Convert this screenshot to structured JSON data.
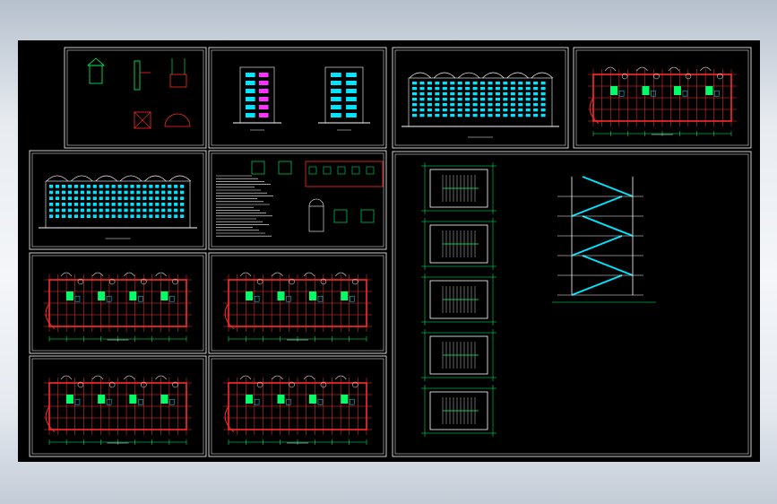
{
  "sheets": [
    {
      "id": "details-1",
      "kind": "details"
    },
    {
      "id": "elevation-side",
      "kind": "side-elevation"
    },
    {
      "id": "elevation-front-top",
      "kind": "front-elevation"
    },
    {
      "id": "plan-top-right",
      "kind": "floor-plan"
    },
    {
      "id": "elevation-front-large",
      "kind": "front-elevation"
    },
    {
      "id": "notes-sheet",
      "kind": "notes"
    },
    {
      "id": "plan-mid-left",
      "kind": "floor-plan"
    },
    {
      "id": "plan-mid-center",
      "kind": "floor-plan"
    },
    {
      "id": "plan-bottom-left",
      "kind": "floor-plan"
    },
    {
      "id": "plan-bottom-center",
      "kind": "floor-plan"
    },
    {
      "id": "stair-sheet",
      "kind": "stair-details"
    }
  ],
  "colors": {
    "background": "#000000",
    "border": "#ffffff",
    "wall": "#ff2a2a",
    "grid": "#ff3333",
    "dim": "#00ff66",
    "cyan": "#00e5ff",
    "fill": "#00ff66",
    "text": "#ffffff",
    "magenta": "#ff33ff"
  }
}
